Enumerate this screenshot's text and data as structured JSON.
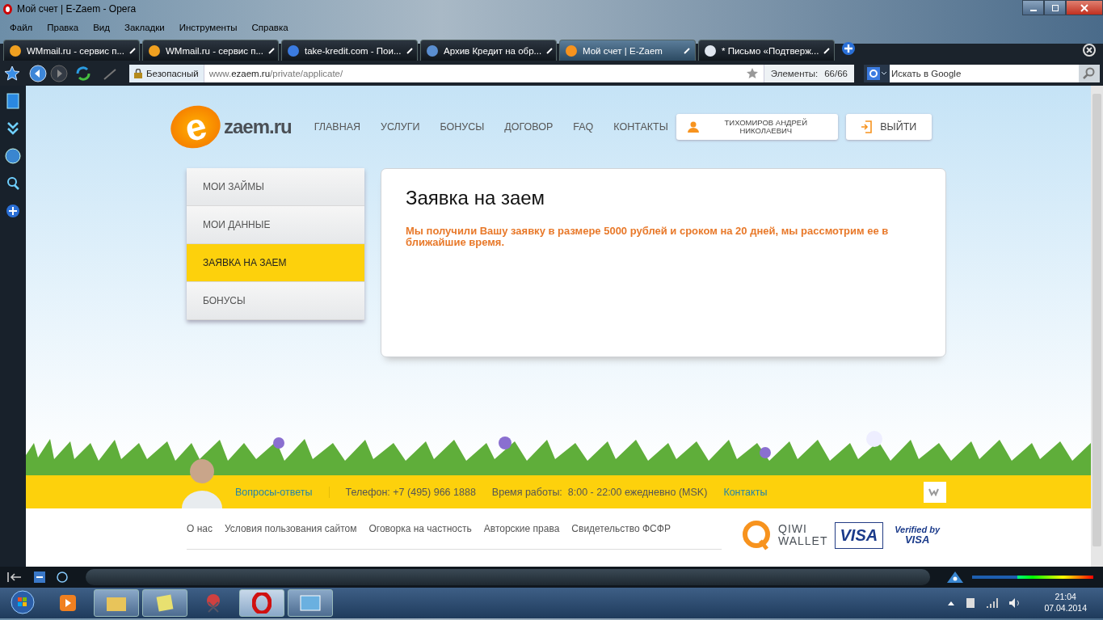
{
  "window": {
    "title": "Мой счет | E-Zaem - Opera"
  },
  "menu": [
    "Файл",
    "Правка",
    "Вид",
    "Закладки",
    "Инструменты",
    "Справка"
  ],
  "tabs": [
    {
      "label": "WMmail.ru - сервис п...",
      "selected": false
    },
    {
      "label": "WMmail.ru - сервис п...",
      "selected": false
    },
    {
      "label": "take-kredit.com - Пои...",
      "selected": false
    },
    {
      "label": "Архив Кредит на обр...",
      "selected": false
    },
    {
      "label": "Мой счет | E-Zaem",
      "selected": true
    },
    {
      "label": "* Письмо «Подтверж...",
      "selected": false
    }
  ],
  "address": {
    "security": "Безопасный",
    "prefix": "www.",
    "domain": "ezaem.ru",
    "path": "/private/applicate/",
    "elements_label": "Элементы:",
    "elements_count": "66/66"
  },
  "search": {
    "placeholder": "Искать в Google"
  },
  "site": {
    "logo_letter": "e",
    "logo_text": "zaem.ru",
    "nav": [
      "ГЛАВНАЯ",
      "УСЛУГИ",
      "БОНУСЫ",
      "ДОГОВОР",
      "FAQ",
      "КОНТАКТЫ"
    ],
    "user": "ТИХОМИРОВ АНДРЕЙ НИКОЛАЕВИЧ",
    "logout": "ВЫЙТИ",
    "sidebar": [
      {
        "label": "МОИ ЗАЙМЫ",
        "selected": false
      },
      {
        "label": "МОИ ДАННЫЕ",
        "selected": false
      },
      {
        "label": "ЗАЯВКА НА ЗАЕМ",
        "selected": true
      },
      {
        "label": "БОНУСЫ",
        "selected": false
      }
    ],
    "card": {
      "title": "Заявка на заем",
      "message": "Мы получили Вашу заявку в размере 5000 рублей и сроком на 20 дней, мы рассмотрим ее в ближайшие время."
    },
    "info_bar": {
      "faq": "Вопросы-ответы",
      "phone": "Телефон: +7 (495) 966 1888",
      "hours": "Время работы:  8:00 - 22:00 ежедневно (MSK)",
      "contacts": "Контакты"
    },
    "footer_links": [
      "О нас",
      "Условия пользования сайтом",
      "Оговорка на частность",
      "Авторские права",
      "Свидетельство ФСФР"
    ],
    "payments": {
      "qiwi_1": "QIWI",
      "qiwi_2": "WALLET",
      "visa": "VISA",
      "verified_1": "Verified by",
      "verified_2": "VISA"
    }
  },
  "opera_bar": {
    "zoom": {
      "level": 0.37
    }
  },
  "taskbar": {
    "time": "21:04",
    "date": "07.04.2014"
  }
}
